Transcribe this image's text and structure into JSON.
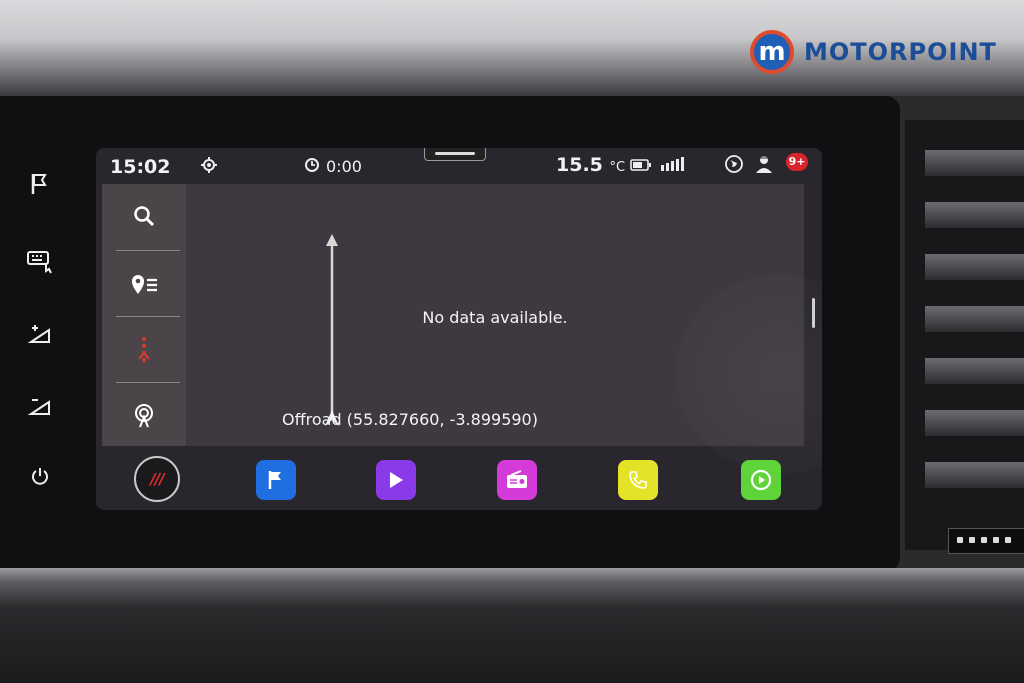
{
  "brand": {
    "badge_letter": "m",
    "name": "MOTORPOINT"
  },
  "status_bar": {
    "time": "15:02",
    "timer": "0:00",
    "temperature": "15.5",
    "temperature_unit": "°C",
    "notification_count": "9+"
  },
  "map": {
    "message": "No data available.",
    "location": "Offroad (55.827660, -3.899590)"
  },
  "nav_menu": {
    "items": [
      "search-icon",
      "location-list-icon",
      "traffic-icon",
      "live-services-icon"
    ]
  },
  "side_buttons": [
    "flag-icon",
    "keyboard-icon",
    "volume-up-icon",
    "volume-down-icon",
    "power-icon"
  ],
  "dock": {
    "home_label": "///",
    "apps": [
      {
        "icon": "navigation-flag-icon",
        "color": "#1f6fe0"
      },
      {
        "icon": "media-play-icon",
        "color": "#8a3ae8"
      },
      {
        "icon": "radio-icon",
        "color": "#d43bd8"
      },
      {
        "icon": "phone-icon",
        "color": "#e3e328"
      },
      {
        "icon": "carplay-icon",
        "color": "#5ed43a"
      }
    ],
    "page_count": 2
  },
  "colors": {
    "screen_bg": "#2a262e",
    "menu_bg": "#4b4549",
    "badge_red": "#d8242c",
    "brand_blue": "#1c4e98",
    "brand_orange": "#e04a2d"
  }
}
